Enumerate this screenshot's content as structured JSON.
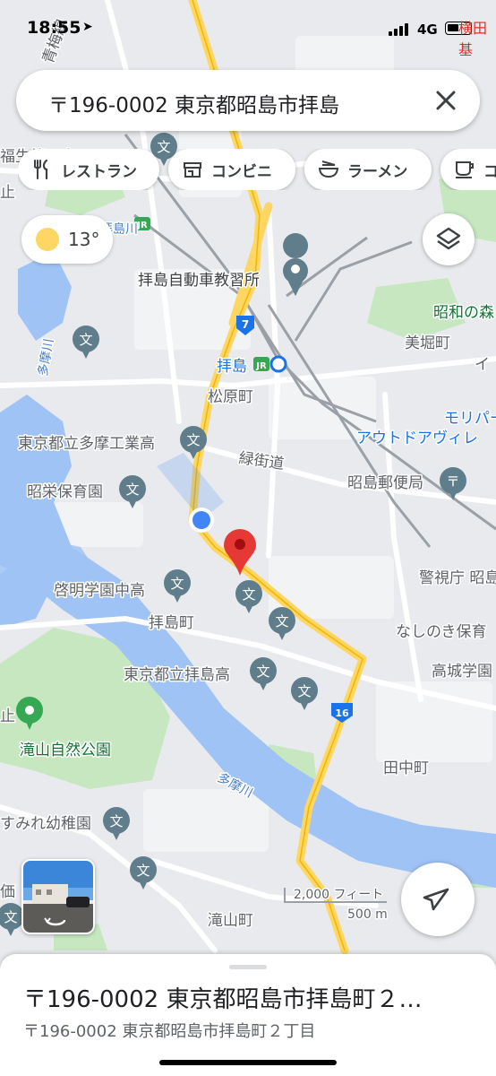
{
  "status_bar": {
    "time": "18:55",
    "network": "4G",
    "carrier_text": "横田基"
  },
  "search": {
    "query": "〒196-0002 東京都昭島市拝島"
  },
  "chips": [
    {
      "label": "レストラン",
      "icon": "fork-knife-icon"
    },
    {
      "label": "コンビニ",
      "icon": "store-icon"
    },
    {
      "label": "ラーメン",
      "icon": "ramen-bowl-icon"
    },
    {
      "label": "コ",
      "icon": "coffee-cup-icon"
    }
  ],
  "weather": {
    "temperature": "13°",
    "icon": "sun-icon"
  },
  "map": {
    "labels": {
      "ome_line": "青梅線",
      "welfare": "福生第二中",
      "haijima_driving": "拝島自動車教習所",
      "showa_forest": "昭和の森",
      "mihoricho": "美堀町",
      "haijima_station": "拝島",
      "matsubaracho": "松原町",
      "moripark": "モリパー",
      "outdoor_village": "アウトドアヴィレ",
      "tama_tech": "東京都立多摩工業高",
      "ryokukaido": "緑街道",
      "shoei": "昭栄保育園",
      "akishima_post": "昭島郵便局",
      "keimei": "啓明学園中高",
      "keishicho": "警視庁 昭島",
      "haijimacho": "拝島町",
      "nashinoki": "なしのき保育",
      "haijima_high": "東京都立拝島高",
      "takajo": "高城学園",
      "takiyama_park": "滝山自然公園",
      "tanakacho": "田中町",
      "tamagawa": "多摩川",
      "tamagawa_upper": "多摩川",
      "sumire": "すみれ幼稚園",
      "takiyamacho": "滝山町",
      "haijima_river": "拝島川",
      "kana_edge": "止",
      "price_edge": "価",
      "i_edge": "イ"
    },
    "route_shields": [
      "7",
      "16"
    ],
    "scale": {
      "feet": "2,000 フィート",
      "meters": "500 m"
    },
    "colors": {
      "water": "#9fc3f5",
      "park": "#c6e7c0",
      "road": "#fdd663",
      "pin": "#e53935",
      "my_location": "#4285f4"
    }
  },
  "place": {
    "title": "〒196-0002 東京都昭島市拝島町２…",
    "subtitle": "〒196-0002 東京都昭島市拝島町２丁目"
  }
}
